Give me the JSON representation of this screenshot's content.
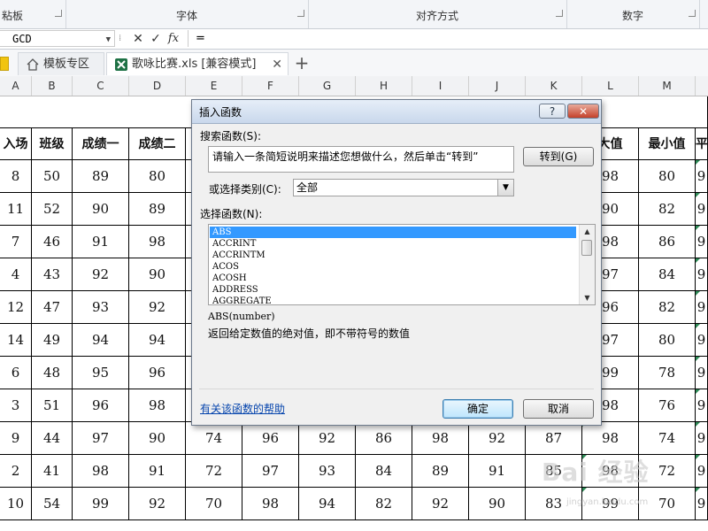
{
  "ribbon": {
    "groups": [
      "粘板",
      "字体",
      "对齐方式",
      "数字"
    ]
  },
  "formula_bar": {
    "name_box": "GCD",
    "cancel_symbol": "✕",
    "enter_symbol": "✓",
    "fx_symbol": "fx",
    "content": "="
  },
  "tabs": [
    {
      "label": "模板专区"
    },
    {
      "label": "歌咏比赛.xls  [兼容模式]",
      "close": "✕"
    }
  ],
  "add_tab_symbol": "+",
  "columns": [
    "A",
    "B",
    "C",
    "D",
    "E",
    "F",
    "G",
    "H",
    "I",
    "J",
    "K",
    "L",
    "M"
  ],
  "sheet": {
    "headers": {
      "a": "入场",
      "b": "班级",
      "c": "成绩一",
      "d": "成绩二",
      "l": "大值",
      "m": "最小值",
      "n": "平"
    },
    "rows": [
      {
        "a": "8",
        "b": "50",
        "c": "89",
        "d": "80",
        "l": "98",
        "m": "80",
        "n": "9"
      },
      {
        "a": "11",
        "b": "52",
        "c": "90",
        "d": "89",
        "l": "90",
        "m": "82",
        "n": "9"
      },
      {
        "a": "7",
        "b": "46",
        "c": "91",
        "d": "98",
        "l": "98",
        "m": "86",
        "n": "9"
      },
      {
        "a": "4",
        "b": "43",
        "c": "92",
        "d": "90",
        "l": "97",
        "m": "84",
        "n": "9"
      },
      {
        "a": "12",
        "b": "47",
        "c": "93",
        "d": "92",
        "l": "96",
        "m": "82",
        "n": "9"
      },
      {
        "a": "14",
        "b": "49",
        "c": "94",
        "d": "94",
        "l": "97",
        "m": "80",
        "n": "9"
      },
      {
        "a": "6",
        "b": "48",
        "c": "95",
        "d": "96",
        "l": "99",
        "m": "78",
        "n": "9"
      },
      {
        "a": "3",
        "b": "51",
        "c": "96",
        "d": "98",
        "l": "98",
        "m": "76",
        "n": "9"
      },
      {
        "a": "9",
        "b": "44",
        "c": "97",
        "d": "90",
        "e": "74",
        "f": "96",
        "g": "92",
        "h": "86",
        "i": "98",
        "j": "92",
        "k": "87",
        "l": "98",
        "m": "74",
        "n": "9"
      },
      {
        "a": "2",
        "b": "41",
        "c": "98",
        "d": "91",
        "e": "72",
        "f": "97",
        "g": "93",
        "h": "84",
        "i": "89",
        "j": "91",
        "k": "85",
        "l": "98",
        "m": "72",
        "n": "9"
      },
      {
        "a": "10",
        "b": "54",
        "c": "99",
        "d": "92",
        "e": "70",
        "f": "98",
        "g": "94",
        "h": "82",
        "i": "92",
        "j": "90",
        "k": "83",
        "l": "99",
        "m": "70",
        "n": "9"
      }
    ]
  },
  "dialog": {
    "title": "插入函数",
    "help_symbol": "?",
    "close_symbol": "✕",
    "search_label": "搜索函数(S):",
    "search_value": "请输入一条简短说明来描述您想做什么，然后单击“转到”",
    "go_button": "转到(G)",
    "category_label": "或选择类别(C):",
    "category_value": "全部",
    "function_label": "选择函数(N):",
    "functions": [
      "ABS",
      "ACCRINT",
      "ACCRINTM",
      "ACOS",
      "ACOSH",
      "ADDRESS",
      "AGGREGATE"
    ],
    "selected_function": "ABS",
    "syntax": "ABS(number)",
    "description": "返回给定数值的绝对值，即不带符号的数值",
    "help_link": "有关该函数的帮助",
    "ok_button": "确定",
    "cancel_button": "取消"
  },
  "watermark": {
    "text": "Bai 经验",
    "url": "jingyan.baidu.com"
  }
}
